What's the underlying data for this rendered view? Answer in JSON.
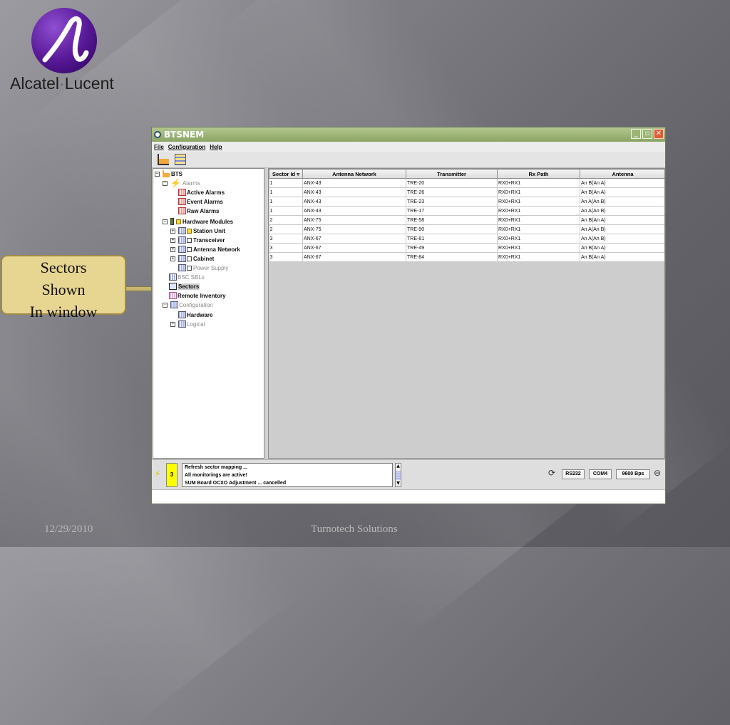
{
  "logo": {
    "name_a": "Alcatel",
    "separator": "·",
    "name_b": "Lucent"
  },
  "callout": {
    "line1": "Sectors",
    "line2": "Shown",
    "line3": "In window"
  },
  "footer": {
    "date": "12/29/2010",
    "company": "Turnotech Solutions"
  },
  "window": {
    "title": "BTSNEM",
    "menu": [
      "File",
      "Configuration",
      "Help"
    ],
    "tree": {
      "root": "BTS",
      "alarms": "Alarms",
      "active_alarms": "Active Alarms",
      "event_alarms": "Event Alarms",
      "raw_alarms": "Raw Alarms",
      "hardware_modules": "Hardware Modules",
      "station_unit": "Station Unit",
      "transceiver": "Transceiver",
      "antenna_network": "Antenna Network",
      "cabinet": "Cabinet",
      "power_supply": "Power Supply",
      "bsc_sbls": "BSC SBLs",
      "sectors": "Sectors",
      "remote_inventory": "Remote Inventory",
      "configuration": "Configuration",
      "hardware": "Hardware",
      "logical": "Logical"
    },
    "table": {
      "columns": [
        "Sector Id",
        "Antenna Network",
        "Transmitter",
        "Rx Path",
        "Antenna"
      ],
      "rows": [
        [
          "1",
          "ANX-43",
          "TRE-20",
          "RX0+RX1",
          "An B(An A)"
        ],
        [
          "1",
          "ANX-43",
          "TRE-26",
          "RX0+RX1",
          "An B(An A)"
        ],
        [
          "1",
          "ANX-43",
          "TRE-23",
          "RX0+RX1",
          "An A(An B)"
        ],
        [
          "1",
          "ANX-43",
          "TRE-17",
          "RX0+RX1",
          "An A(An B)"
        ],
        [
          "2",
          "ANX-75",
          "TRE-58",
          "RX0+RX1",
          "An B(An A)"
        ],
        [
          "2",
          "ANX-75",
          "TRE-90",
          "RX0+RX1",
          "An A(An B)"
        ],
        [
          "3",
          "ANX-67",
          "TRE-81",
          "RX0+RX1",
          "An A(An B)"
        ],
        [
          "3",
          "ANX-67",
          "TRE-49",
          "RX0+RX1",
          "An B(An A)"
        ],
        [
          "3",
          "ANX-67",
          "TRE-84",
          "RX0+RX1",
          "An B(An A)"
        ]
      ]
    },
    "status": {
      "alarm_count": "3",
      "log": [
        "Refresh sector mapping ...",
        "All monitorings are active!",
        "SUM Board OCXO Adjustment ... cancelled"
      ],
      "interface": "RS232",
      "port": "COM4",
      "baud": "9600 Bps"
    }
  }
}
